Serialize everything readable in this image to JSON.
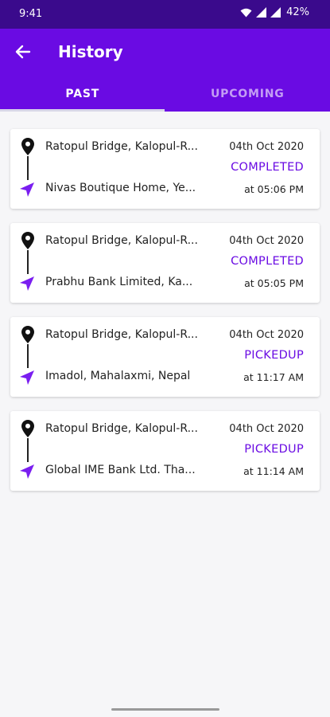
{
  "status_bar": {
    "time": "9:41",
    "battery": "42%"
  },
  "app_bar": {
    "title": "History",
    "back_icon": "arrow-left-icon"
  },
  "tabs": [
    {
      "label": "PAST",
      "active": true
    },
    {
      "label": "UPCOMING",
      "active": false
    }
  ],
  "colors": {
    "accent": "#6a0be3",
    "status_bar": "#3a0a8c"
  },
  "history": [
    {
      "from": "Ratopul Bridge, Kalopul-R...",
      "to": "Nivas Boutique Home, Ye...",
      "date": "04th Oct 2020",
      "status": "COMPLETED",
      "time": "at 05:06 PM"
    },
    {
      "from": "Ratopul Bridge, Kalopul-R...",
      "to": "Prabhu Bank Limited, Ka...",
      "date": "04th Oct 2020",
      "status": "COMPLETED",
      "time": "at 05:05 PM"
    },
    {
      "from": "Ratopul Bridge, Kalopul-R...",
      "to": "Imadol, Mahalaxmi, Nepal",
      "date": "04th Oct 2020",
      "status": "PICKEDUP",
      "time": "at 11:17 AM"
    },
    {
      "from": "Ratopul Bridge, Kalopul-R...",
      "to": "Global IME Bank Ltd. Tha...",
      "date": "04th Oct 2020",
      "status": "PICKEDUP",
      "time": "at 11:14 AM"
    }
  ]
}
